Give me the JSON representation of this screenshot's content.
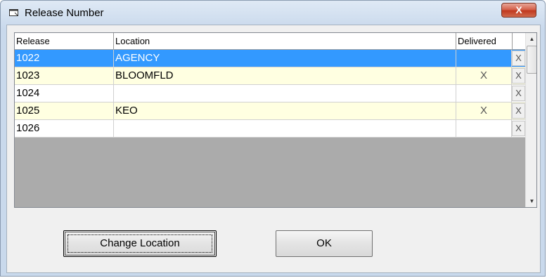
{
  "window": {
    "title": "Release Number",
    "close_label": "X"
  },
  "grid": {
    "columns": [
      "Release",
      "Location",
      "Delivered"
    ],
    "rows": [
      {
        "release": "1022",
        "location": "AGENCY",
        "delivered": "",
        "action": "X"
      },
      {
        "release": "1023",
        "location": "BLOOMFLD",
        "delivered": "X",
        "action": "X"
      },
      {
        "release": "1024",
        "location": "",
        "delivered": "",
        "action": "X"
      },
      {
        "release": "1025",
        "location": "KEO",
        "delivered": "X",
        "action": "X"
      },
      {
        "release": "1026",
        "location": "",
        "delivered": "",
        "action": "X"
      }
    ]
  },
  "buttons": {
    "change_location": "Change Location",
    "ok": "OK"
  },
  "colors": {
    "selected_row": "#3399ff",
    "alt_row": "#ffffe1",
    "grid_empty": "#ababab"
  }
}
